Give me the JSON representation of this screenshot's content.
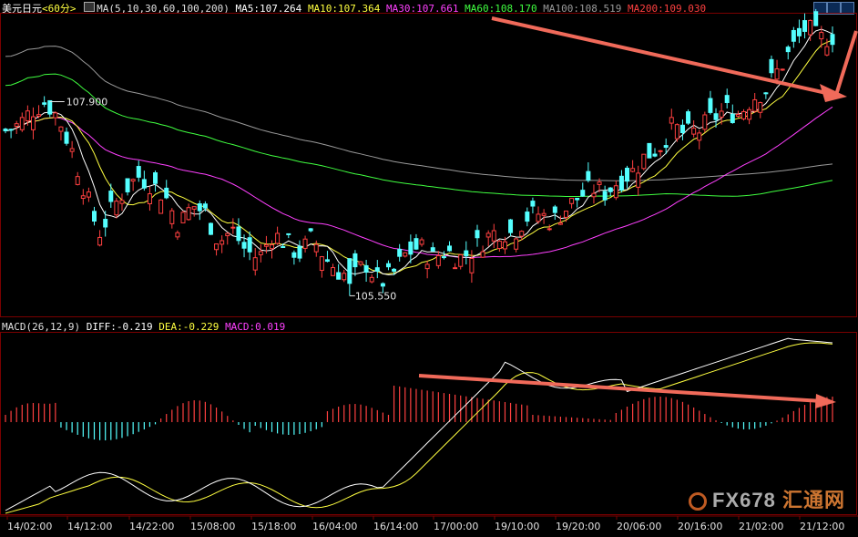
{
  "header": {
    "symbol": "美元日元",
    "period": "<60分>",
    "ma_label": "MA(5,10,30,60,100,200)",
    "ma5": "MA5:107.264",
    "ma10": "MA10:107.364",
    "ma30": "MA30:107.661",
    "ma60": "MA60:108.170",
    "ma100": "MA100:108.519",
    "ma200": "MA200:109.030"
  },
  "macd_header": {
    "label": "MACD(26,12,9)",
    "diff": "DIFF:-0.219",
    "dea": "DEA:-0.229",
    "macd": "MACD:0.019"
  },
  "watermark": {
    "brand": "FX678",
    "cn": "汇通网"
  },
  "colors": {
    "up": "#ff4040",
    "down": "#54ffff",
    "ma5": "#ffffff",
    "ma10": "#ffff40",
    "ma30": "#ff40ff",
    "ma60": "#40ff40",
    "ma100": "#9a9a9a",
    "ma200": "#ff4040",
    "arrow": "#f06a5a"
  },
  "chart_data": [
    {
      "type": "candlestick",
      "title": "美元日元 60分",
      "x_ticks": [
        "14/02:00",
        "14/12:00",
        "14/22:00",
        "15/08:00",
        "15/18:00",
        "16/04:00",
        "16/14:00",
        "17/00:00",
        "19/10:00",
        "19/20:00",
        "20/06:00",
        "20/16:00",
        "21/02:00",
        "21/12:00"
      ],
      "annotations": {
        "high": "107.900",
        "low": "105.550"
      },
      "close_path": [
        107.55,
        107.62,
        107.8,
        107.9,
        107.7,
        107.3,
        106.8,
        106.3,
        106.6,
        106.85,
        107.0,
        106.9,
        106.75,
        106.4,
        106.65,
        106.55,
        106.2,
        106.35,
        106.1,
        106.0,
        106.3,
        106.2,
        106.05,
        106.25,
        106.0,
        105.85,
        105.75,
        105.95,
        105.7,
        105.8,
        106.05,
        106.15,
        106.0,
        106.1,
        106.0,
        106.1,
        106.25,
        106.35,
        106.3,
        106.5,
        106.55,
        106.45,
        106.6,
        106.75,
        106.85,
        106.8,
        106.95,
        107.05,
        107.25,
        107.35,
        107.6,
        107.5,
        107.55,
        107.7,
        107.8,
        107.75,
        107.95,
        108.05,
        108.3,
        108.55,
        108.8,
        108.65,
        108.7
      ],
      "ma_lines": [
        "MA5",
        "MA10",
        "MA30",
        "MA60",
        "MA100",
        "MA200"
      ]
    },
    {
      "type": "bar+line",
      "title": "MACD(26,12,9)",
      "series": [
        {
          "name": "DIFF",
          "value": -0.219
        },
        {
          "name": "DEA",
          "value": -0.229
        },
        {
          "name": "MACD",
          "value": 0.019
        }
      ]
    }
  ]
}
